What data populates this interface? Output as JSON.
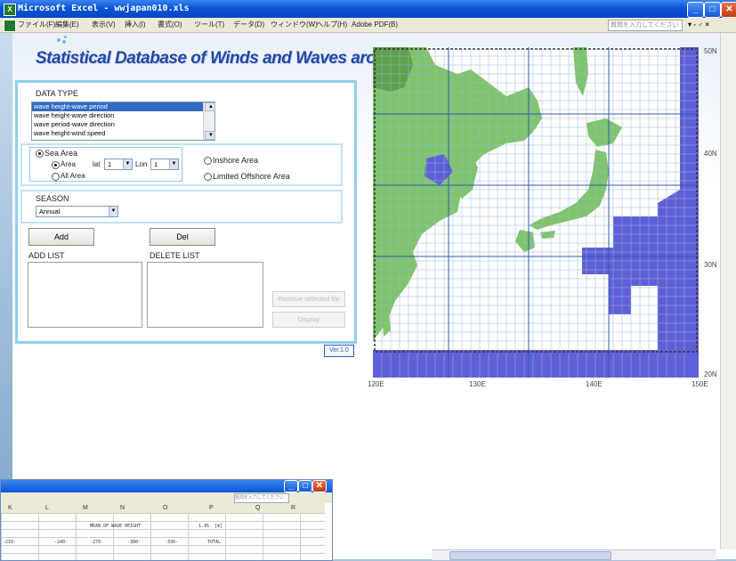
{
  "window": {
    "title": "Microsoft Excel - wwjapan010.xls",
    "min": "_",
    "max": "□",
    "close": "✕"
  },
  "menu": {
    "items": [
      "ファイル(F)",
      "編集(E)",
      "表示(V)",
      "挿入(I)",
      "書式(O)",
      "ツール(T)",
      "データ(D)",
      "ウィンドウ(W)",
      "ヘルプ(H)",
      "Adobe PDF(B)"
    ],
    "help_placeholder": "質問を入力してください"
  },
  "app": {
    "heading": "Statistical Database of Winds and Waves around Japan",
    "version": "Ver.1.0"
  },
  "data_type": {
    "label": "DATA TYPE",
    "items": [
      "wave height-wave period",
      "wave height-wave direction",
      "wave period-wave direction",
      "wave height-wind speed"
    ],
    "selected_index": 0
  },
  "area": {
    "sea_area": "Sea Area",
    "area": "Area",
    "lat_label": "lat",
    "lat_value": "1",
    "lon_label": "Lon",
    "lon_value": "1",
    "all_area": "All  Area",
    "inshore": "Inshore Area",
    "offshore": "Limited Offshore Area"
  },
  "season": {
    "label": "SEASON",
    "value": "Annual"
  },
  "buttons": {
    "add": "Add",
    "del": "Del",
    "remove": "Remove selected file",
    "display": "Display"
  },
  "lists": {
    "add_list": "ADD LIST",
    "delete_list": "DELETE LIST"
  },
  "map": {
    "lat_labels": [
      "50N",
      "40N",
      "30N",
      "20N"
    ],
    "lon_labels": [
      "120E",
      "130E",
      "140E",
      "150E"
    ]
  },
  "sheet": {
    "columns": [
      "K",
      "L",
      "M",
      "N",
      "O",
      "P",
      "Q",
      "R"
    ],
    "cell_mean": "MEAN OF WAVE HEIGHT",
    "cell_value": "1.95",
    "cell_unit": "[m]",
    "row_labels": [
      "-210-",
      "-240-",
      "-270-",
      "-300-",
      "-330-",
      "TOTAL"
    ]
  },
  "colors": {
    "title_blue": "#0a55d8",
    "panel_border": "#8fd0ef",
    "heading_blue": "#2547a6",
    "sea": "#5f5fd8",
    "land": "#7fc46a"
  }
}
